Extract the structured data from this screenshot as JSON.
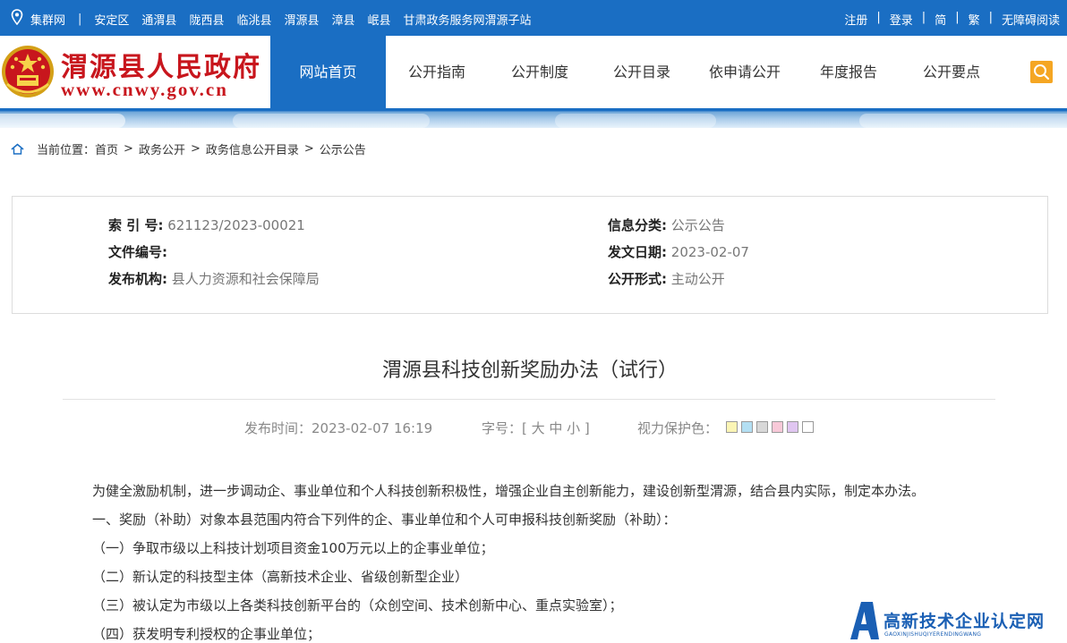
{
  "topbar": {
    "links": [
      "集群网",
      "安定区",
      "通渭县",
      "陇西县",
      "临洮县",
      "渭源县",
      "漳县",
      "岷县",
      "甘肃政务服务网渭源子站"
    ],
    "right": [
      "注册",
      "登录",
      "简",
      "繁",
      "无障碍阅读"
    ]
  },
  "header": {
    "site_name": "渭源县人民政府",
    "site_url": "www.cnwy.gov.cn",
    "nav": [
      "网站首页",
      "公开指南",
      "公开制度",
      "公开目录",
      "依申请公开",
      "年度报告",
      "公开要点"
    ]
  },
  "breadcrumb": {
    "prefix": "当前位置：",
    "items": [
      "首页",
      "政务公开",
      "政务信息公开目录",
      "公示公告"
    ]
  },
  "info": {
    "index_label": "索 引 号:",
    "index_value": "621123/2023-00021",
    "docno_label": "文件编号:",
    "docno_value": "",
    "org_label": "发布机构:",
    "org_value": "县人力资源和社会保障局",
    "category_label": "信息分类:",
    "category_value": "公示公告",
    "date_label": "发文日期:",
    "date_value": "2023-02-07",
    "form_label": "公开形式:",
    "form_value": "主动公开"
  },
  "article": {
    "title": "渭源县科技创新奖励办法（试行）",
    "publish_time": "发布时间：2023-02-07 16:19",
    "font_size": "字号：[ 大 中 小 ]",
    "eye_protect": "视力保护色：",
    "swatch_colors": [
      "#fbf5b5",
      "#b3dff3",
      "#d8d8d8",
      "#f8c9d8",
      "#e0c6f1",
      "#ffffff"
    ],
    "paragraphs": [
      "为健全激励机制，进一步调动企、事业单位和个人科技创新积极性，增强企业自主创新能力，建设创新型渭源，结合县内实际，制定本办法。",
      "一、奖励（补助）对象本县范围内符合下列件的企、事业单位和个人可申报科技创新奖励（补助）：",
      "（一）争取市级以上科技计划项目资金100万元以上的企事业单位；",
      "（二）新认定的科技型主体（高新技术企业、省级创新型企业）",
      "（三）被认定为市级以上各类科技创新平台的（众创空间、技术创新中心、重点实验室）；",
      "（四）获发明专利授权的企事业单位；"
    ]
  },
  "watermark": {
    "text": "高新技术企业认定网",
    "sub": "GAOXINJISHUQIYERENDINGWANG"
  },
  "colors": {
    "brand_blue": "#1a6ec3",
    "site_red": "#c8161d",
    "search_orange": "#f5a623"
  }
}
